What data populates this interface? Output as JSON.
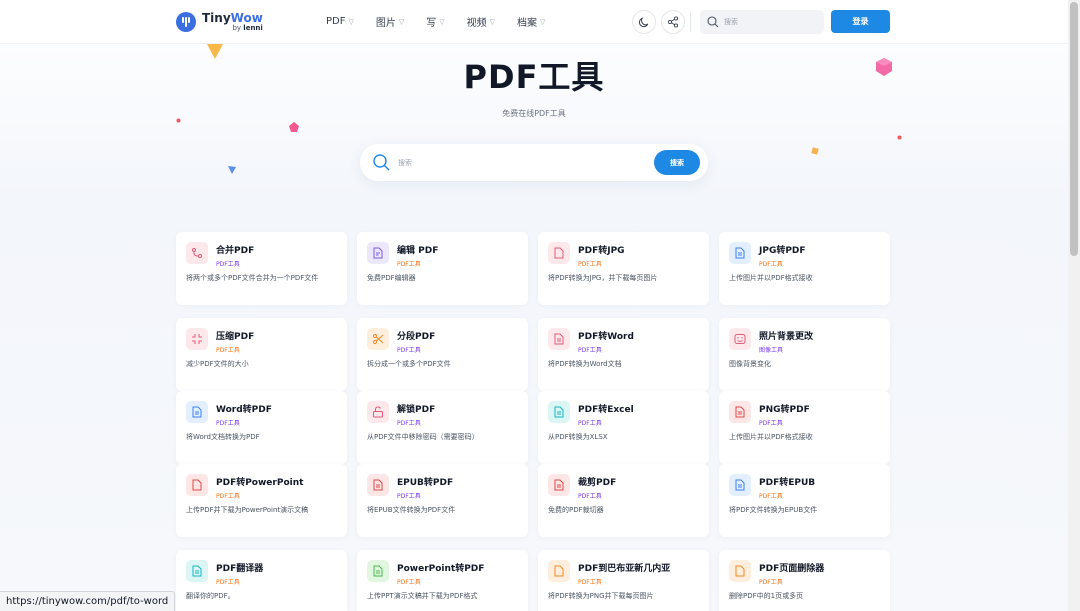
{
  "brand": {
    "title_main": "Tiny",
    "title_accent": "Wow",
    "by": "by",
    "by_name": "lenni"
  },
  "nav": [
    {
      "label": "PDF"
    },
    {
      "label": "图片"
    },
    {
      "label": "写"
    },
    {
      "label": "视频"
    },
    {
      "label": "档案"
    }
  ],
  "header": {
    "search_placeholder": "搜索",
    "login_label": "登录"
  },
  "hero": {
    "title": "PDF工具",
    "subtitle": "免费在线PDF工具",
    "search_placeholder": "搜索",
    "search_button": "搜索"
  },
  "colors": {
    "accent": "#1e88e5",
    "brand": "#3b6fe0",
    "cat_orange": "#f97316",
    "cat_purple": "#7c3aed"
  },
  "tools": [
    {
      "title": "合并PDF",
      "category": "PDF工具",
      "desc": "将两个或多个PDF文件合并为一个PDF文件",
      "icon": "merge-icon",
      "tint": "pink",
      "cat_color": "purple"
    },
    {
      "title": "编辑 PDF",
      "category": "PDF工具",
      "desc": "免费PDF编辑器",
      "icon": "edit-document-icon",
      "tint": "purple",
      "cat_color": "orange"
    },
    {
      "title": "PDF转JPG",
      "category": "PDF工具",
      "desc": "将PDF转换为JPG，并下载每页图片",
      "icon": "document-icon",
      "tint": "pink",
      "cat_color": "orange"
    },
    {
      "title": "JPG转PDF",
      "category": "PDF工具",
      "desc": "上传图片并以PDF格式接收",
      "icon": "document-text-icon",
      "tint": "blue",
      "cat_color": "orange"
    },
    {
      "title": "压缩PDF",
      "category": "PDF工具",
      "desc": "减少PDF文件的大小",
      "icon": "compress-icon",
      "tint": "pink",
      "cat_color": "orange"
    },
    {
      "title": "分段PDF",
      "category": "PDF工具",
      "desc": "拆分成一个或多个PDF文件",
      "icon": "scissors-icon",
      "tint": "orange",
      "cat_color": "purple"
    },
    {
      "title": "PDF转Word",
      "category": "PDF工具",
      "desc": "将PDF转换为Word文档",
      "icon": "document-text-icon",
      "tint": "pink",
      "cat_color": "purple"
    },
    {
      "title": "照片背景更改",
      "category": "图像工具",
      "desc": "图像背景变化",
      "icon": "photo-icon",
      "tint": "pink",
      "cat_color": "purple"
    },
    {
      "title": "Word转PDF",
      "category": "PDF工具",
      "desc": "将Word文档转换为PDF",
      "icon": "document-text-icon",
      "tint": "blue",
      "cat_color": "purple"
    },
    {
      "title": "解锁PDF",
      "category": "PDF工具",
      "desc": "从PDF文件中移除密码（需要密码）",
      "icon": "unlock-icon",
      "tint": "pink",
      "cat_color": "purple"
    },
    {
      "title": "PDF转Excel",
      "category": "PDF工具",
      "desc": "从PDF转换为XLSX",
      "icon": "document-text-icon",
      "tint": "cyan",
      "cat_color": "purple"
    },
    {
      "title": "PNG转PDF",
      "category": "PDF工具",
      "desc": "上传图片并以PDF格式接收",
      "icon": "document-text-icon",
      "tint": "red",
      "cat_color": "purple"
    },
    {
      "title": "PDF转PowerPoint",
      "category": "PDF工具",
      "desc": "上传PDF并下载为PowerPoint演示文稿",
      "icon": "document-icon",
      "tint": "red",
      "cat_color": "orange"
    },
    {
      "title": "EPUB转PDF",
      "category": "PDF工具",
      "desc": "将EPUB文件转换为PDF文件",
      "icon": "document-text-icon",
      "tint": "red",
      "cat_color": "purple"
    },
    {
      "title": "裁剪PDF",
      "category": "PDF工具",
      "desc": "免费的PDF裁切器",
      "icon": "document-text-icon",
      "tint": "red",
      "cat_color": "purple"
    },
    {
      "title": "PDF转EPUB",
      "category": "PDF工具",
      "desc": "将PDF文件转换为EPUB文件",
      "icon": "document-text-icon",
      "tint": "blue",
      "cat_color": "orange"
    },
    {
      "title": "PDF翻译器",
      "category": "PDF工具",
      "desc": "翻译你的PDF。",
      "icon": "document-text-icon",
      "tint": "cyan",
      "cat_color": "orange"
    },
    {
      "title": "PowerPoint转PDF",
      "category": "PDF工具",
      "desc": "上传PPT演示文稿并下载为PDF格式",
      "icon": "document-text-icon",
      "tint": "green",
      "cat_color": "orange"
    },
    {
      "title": "PDF到巴布亚新几内亚",
      "category": "PDF工具",
      "desc": "将PDF转换为PNG并下载每页图片",
      "icon": "document-icon",
      "tint": "orange",
      "cat_color": "orange"
    },
    {
      "title": "PDF页面删除器",
      "category": "PDF工具",
      "desc": "删除PDF中的1页或多页",
      "icon": "document-icon",
      "tint": "orange",
      "cat_color": "orange"
    }
  ],
  "status_url": "https://tinywow.com/pdf/to-word"
}
